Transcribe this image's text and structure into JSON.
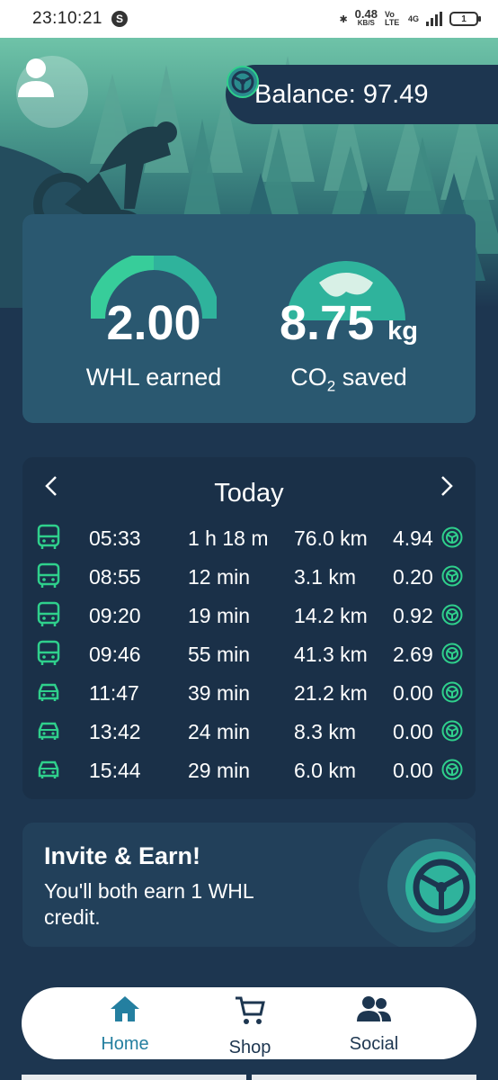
{
  "status_bar": {
    "time": "23:10:21",
    "net_speed": "0.48",
    "net_unit": "KB/S",
    "volte": "Vo LTE",
    "signal": "4G",
    "battery": "1"
  },
  "header": {
    "balance_label": "Balance: 97.49",
    "icons": [
      "avatar-icon",
      "wheel-coin-icon"
    ]
  },
  "stats": {
    "whl_value": "2.00",
    "whl_label": "WHL earned",
    "co2_value": "8.75",
    "co2_unit": "kg",
    "co2_label_prefix": "CO",
    "co2_label_sub": "2",
    "co2_label_suffix": " saved"
  },
  "trips": {
    "title": "Today",
    "rows": [
      {
        "mode": "bus",
        "time": "05:33",
        "duration": "1 h 18 m",
        "distance": "76.0 km",
        "earned": "4.94"
      },
      {
        "mode": "bus",
        "time": "08:55",
        "duration": "12 min",
        "distance": "3.1 km",
        "earned": "0.20"
      },
      {
        "mode": "bus",
        "time": "09:20",
        "duration": "19 min",
        "distance": "14.2 km",
        "earned": "0.92"
      },
      {
        "mode": "bus",
        "time": "09:46",
        "duration": "55 min",
        "distance": "41.3 km",
        "earned": "2.69"
      },
      {
        "mode": "car",
        "time": "11:47",
        "duration": "39 min",
        "distance": "21.2 km",
        "earned": "0.00"
      },
      {
        "mode": "car",
        "time": "13:42",
        "duration": "24 min",
        "distance": "8.3 km",
        "earned": "0.00"
      },
      {
        "mode": "car",
        "time": "15:44",
        "duration": "29 min",
        "distance": "6.0 km",
        "earned": "0.00"
      }
    ]
  },
  "invite": {
    "heading": "Invite & Earn!",
    "body": "You'll both earn 1 WHL credit."
  },
  "bottom_nav": {
    "items": [
      {
        "label": "Home",
        "icon": "home-icon"
      },
      {
        "label": "Shop",
        "icon": "cart-icon"
      },
      {
        "label": "Social",
        "icon": "people-icon"
      }
    ]
  },
  "colors": {
    "background": "#1d3650",
    "card": "#2a5870",
    "accent": "#2fd08c",
    "active_nav": "#247fa0"
  }
}
